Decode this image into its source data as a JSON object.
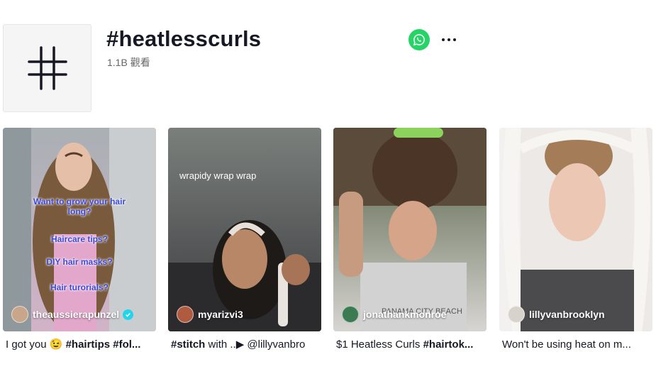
{
  "hashtag": {
    "icon": "hash-icon",
    "title": "#heatlesscurls",
    "views": "1.1B 觀看"
  },
  "actions": {
    "share_icon": "whatsapp-icon",
    "more_icon": "more-horizontal-icon"
  },
  "videos": [
    {
      "author": "theaussierapunzel",
      "verified": true,
      "caption_pre": "I got you ",
      "caption_emoji": "😉",
      "caption_tag": " #hairtips #fol...",
      "overlay_lines": [
        "Want to grow your hair long?",
        "Haircare tips?",
        "DIY hair masks?",
        "Hair turorials?"
      ],
      "colors": {
        "top": "#9aa2a7",
        "bottom": "#c7a6c2"
      }
    },
    {
      "author": "myarizvi3",
      "verified": false,
      "caption_tag": "#stitch",
      "caption_rest": " with ..▶ @lillyvanbro",
      "overlay_lines": [
        "wrapidy wrap wrap"
      ],
      "colors": {
        "top": "#6d726f",
        "bottom": "#3a3b3d"
      }
    },
    {
      "author": "jonathankmonroe",
      "verified": false,
      "caption_pre": "$1 Heatless Curls ",
      "caption_tag": "#hairtok...",
      "overlay_lines": [],
      "colors": {
        "top": "#5a4b3a",
        "bottom": "#cfcfcf"
      }
    },
    {
      "author": "lillyvanbrooklyn",
      "verified": false,
      "caption_pre": "Won't be using heat on m...",
      "overlay_lines": [],
      "colors": {
        "top": "#e9e6e4",
        "bottom": "#4a4b4d"
      }
    }
  ]
}
